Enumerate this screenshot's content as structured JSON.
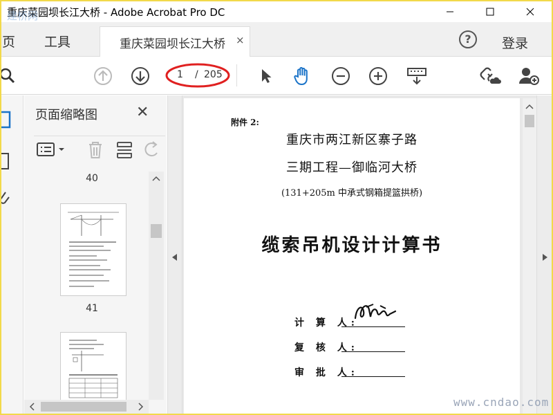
{
  "window": {
    "title": "重庆菜园坝长江大桥 - Adobe Acrobat Pro DC",
    "overlay_watermark": "建桥网"
  },
  "tabs": {
    "home": "主页",
    "tools": "工具",
    "document_tab": "重庆菜园坝长江大桥",
    "tab_close": "×",
    "help": "?",
    "login": "登录"
  },
  "toolbar": {
    "current_page": "1",
    "separator": "/",
    "total_pages": "205"
  },
  "thumbnail_panel": {
    "title": "页面缩略图",
    "close": "✕",
    "page_labels": [
      "40",
      "41"
    ]
  },
  "document": {
    "attachment": "附件 2:",
    "title_line1": "重庆市两江新区寨子路",
    "title_line2": "三期工程—御临河大桥",
    "spec": "(131+205m 中承式钢箱提篮拱桥)",
    "main_title": "缆索吊机设计计算书",
    "calculator_label": "计 算 人:",
    "reviewer_label": "复 核 人:",
    "approver_label": "审 批 人:"
  },
  "footer_watermark": "www.cndao.com",
  "colors": {
    "frame_border": "#f2d94a",
    "annotation_ring": "#e02020",
    "hand_tool": "#1a73c8"
  }
}
